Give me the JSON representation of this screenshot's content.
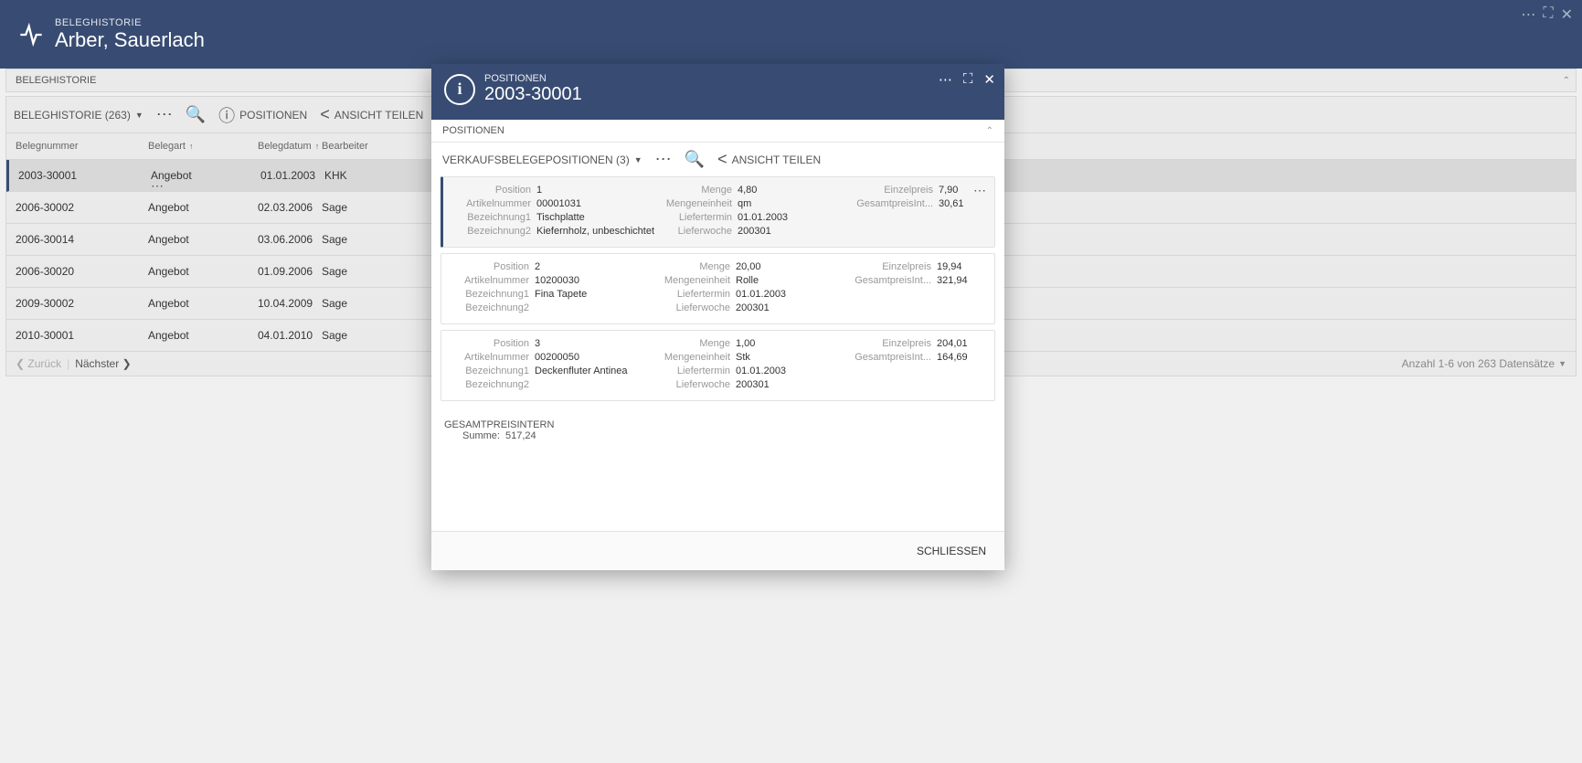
{
  "header": {
    "subtitle": "BELEGHISTORIE",
    "title": "Arber, Sauerlach"
  },
  "breadcrumb": "BELEGHISTORIE",
  "toolbar": {
    "list_label": "BELEGHISTORIE (263)",
    "positionen": "POSITIONEN",
    "share": "ANSICHT TEILEN"
  },
  "table": {
    "columns": {
      "belegnummer": "Belegnummer",
      "belegart": "Belegart",
      "belegdatum": "Belegdatum",
      "bearbeiter": "Bearbeiter"
    },
    "rows": [
      {
        "belegnummer": "2003-30001",
        "belegart": "Angebot",
        "belegdatum": "01.01.2003",
        "bearbeiter": "KHK",
        "selected": true
      },
      {
        "belegnummer": "2006-30002",
        "belegart": "Angebot",
        "belegdatum": "02.03.2006",
        "bearbeiter": "Sage"
      },
      {
        "belegnummer": "2006-30014",
        "belegart": "Angebot",
        "belegdatum": "03.06.2006",
        "bearbeiter": "Sage"
      },
      {
        "belegnummer": "2006-30020",
        "belegart": "Angebot",
        "belegdatum": "01.09.2006",
        "bearbeiter": "Sage"
      },
      {
        "belegnummer": "2009-30002",
        "belegart": "Angebot",
        "belegdatum": "10.04.2009",
        "bearbeiter": "Sage"
      },
      {
        "belegnummer": "2010-30001",
        "belegart": "Angebot",
        "belegdatum": "04.01.2010",
        "bearbeiter": "Sage"
      }
    ],
    "footer": {
      "back": "Zurück",
      "next": "Nächster",
      "count": "Anzahl 1-6 von 263 Datensätze"
    }
  },
  "modal": {
    "subtitle": "POSITIONEN",
    "title": "2003-30001",
    "section": "POSITIONEN",
    "toolbar": {
      "list_label": "VERKAUFSBELEGEPOSITIONEN (3)",
      "share": "ANSICHT TEILEN"
    },
    "labels": {
      "position": "Position",
      "artikelnummer": "Artikelnummer",
      "bezeichnung1": "Bezeichnung1",
      "bezeichnung2": "Bezeichnung2",
      "menge": "Menge",
      "mengeneinheit": "Mengeneinheit",
      "liefertermin": "Liefertermin",
      "lieferwoche": "Lieferwoche",
      "einzelpreis": "Einzelpreis",
      "gesamtpreis": "GesamtpreisInt..."
    },
    "positions": [
      {
        "pos": "1",
        "art": "00001031",
        "bez1": "Tischplatte",
        "bez2": "Kiefernholz, unbeschichtet",
        "menge": "4,80",
        "einheit": "qm",
        "termin": "01.01.2003",
        "woche": "200301",
        "einzel": "7,90",
        "gesamt": "30,61",
        "selected": true
      },
      {
        "pos": "2",
        "art": "10200030",
        "bez1": "Fina Tapete",
        "bez2": "",
        "menge": "20,00",
        "einheit": "Rolle",
        "termin": "01.01.2003",
        "woche": "200301",
        "einzel": "19,94",
        "gesamt": "321,94"
      },
      {
        "pos": "3",
        "art": "00200050",
        "bez1": "Deckenfluter Antinea",
        "bez2": "",
        "menge": "1,00",
        "einheit": "Stk",
        "termin": "01.01.2003",
        "woche": "200301",
        "einzel": "204,01",
        "gesamt": "164,69"
      }
    ],
    "summary": {
      "label": "GESAMTPREISINTERN",
      "summe_lbl": "Summe:",
      "summe_val": "517,24"
    },
    "close": "SCHLIESSEN"
  }
}
